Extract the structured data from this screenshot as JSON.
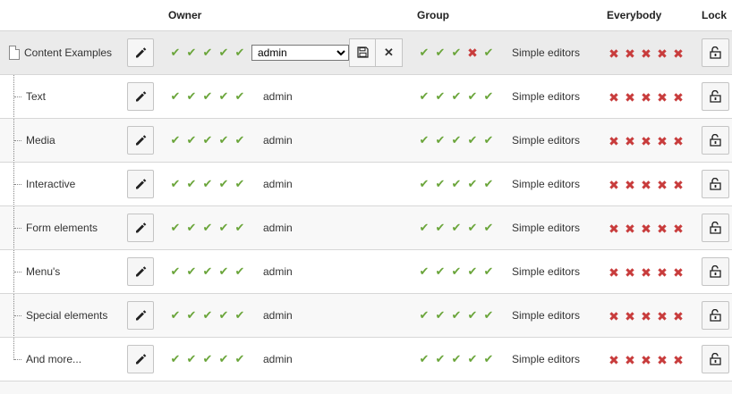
{
  "header": {
    "owner": "Owner",
    "group": "Group",
    "everybody": "Everybody",
    "lock": "Lock"
  },
  "rows": [
    {
      "title": "Content Examples",
      "owner": "admin",
      "group": "Simple editors",
      "owner_perms": [
        1,
        1,
        1,
        1,
        1
      ],
      "group_perms": [
        1,
        1,
        1,
        0,
        1
      ],
      "everybody_perms": [
        0,
        0,
        0,
        0,
        0
      ],
      "editing": true
    },
    {
      "title": "Text",
      "owner": "admin",
      "group": "Simple editors",
      "owner_perms": [
        1,
        1,
        1,
        1,
        1
      ],
      "group_perms": [
        1,
        1,
        1,
        1,
        1
      ],
      "everybody_perms": [
        0,
        0,
        0,
        0,
        0
      ]
    },
    {
      "title": "Media",
      "owner": "admin",
      "group": "Simple editors",
      "owner_perms": [
        1,
        1,
        1,
        1,
        1
      ],
      "group_perms": [
        1,
        1,
        1,
        1,
        1
      ],
      "everybody_perms": [
        0,
        0,
        0,
        0,
        0
      ]
    },
    {
      "title": "Interactive",
      "owner": "admin",
      "group": "Simple editors",
      "owner_perms": [
        1,
        1,
        1,
        1,
        1
      ],
      "group_perms": [
        1,
        1,
        1,
        1,
        1
      ],
      "everybody_perms": [
        0,
        0,
        0,
        0,
        0
      ]
    },
    {
      "title": "Form elements",
      "owner": "admin",
      "group": "Simple editors",
      "owner_perms": [
        1,
        1,
        1,
        1,
        1
      ],
      "group_perms": [
        1,
        1,
        1,
        1,
        1
      ],
      "everybody_perms": [
        0,
        0,
        0,
        0,
        0
      ]
    },
    {
      "title": "Menu's",
      "owner": "admin",
      "group": "Simple editors",
      "owner_perms": [
        1,
        1,
        1,
        1,
        1
      ],
      "group_perms": [
        1,
        1,
        1,
        1,
        1
      ],
      "everybody_perms": [
        0,
        0,
        0,
        0,
        0
      ]
    },
    {
      "title": "Special elements",
      "owner": "admin",
      "group": "Simple editors",
      "owner_perms": [
        1,
        1,
        1,
        1,
        1
      ],
      "group_perms": [
        1,
        1,
        1,
        1,
        1
      ],
      "everybody_perms": [
        0,
        0,
        0,
        0,
        0
      ]
    },
    {
      "title": "And more...",
      "owner": "admin",
      "group": "Simple editors",
      "owner_perms": [
        1,
        1,
        1,
        1,
        1
      ],
      "group_perms": [
        1,
        1,
        1,
        1,
        1
      ],
      "everybody_perms": [
        0,
        0,
        0,
        0,
        0
      ]
    }
  ],
  "owner_select": {
    "value": "admin",
    "options": [
      "admin"
    ]
  },
  "icons": {
    "edit": "pencil-icon",
    "save": "save-icon",
    "cancel": "close-icon",
    "lock": "unlock-icon",
    "page": "page-icon",
    "allowed": "check-icon",
    "denied": "cross-icon"
  },
  "colors": {
    "allowed": "#6aa53a",
    "denied": "#c83c3c"
  }
}
